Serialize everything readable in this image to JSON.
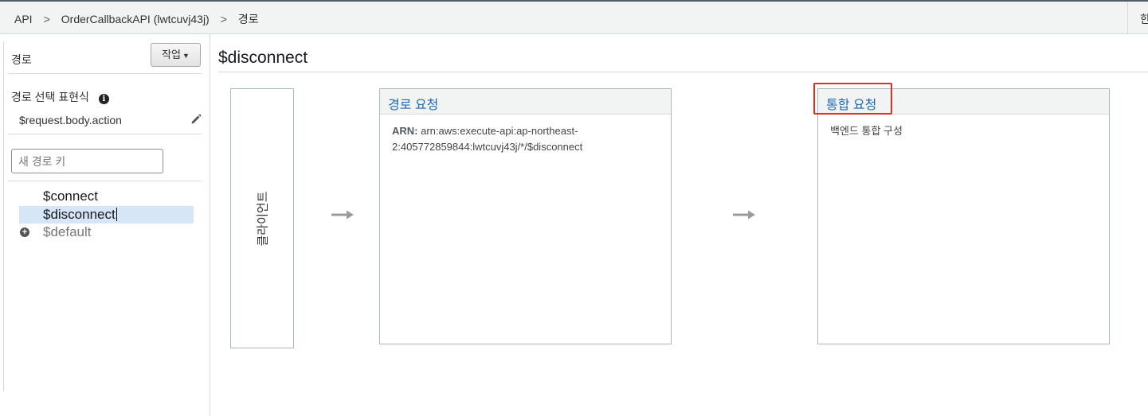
{
  "breadcrumb": {
    "items": [
      "API",
      "OrderCallbackAPI (lwtcuvj43j)",
      "경로"
    ],
    "separator": ">",
    "right_partial": "한"
  },
  "sidebar": {
    "title": "경로",
    "actions_button": "작업",
    "selection_expression_label": "경로 선택 표현식",
    "selection_expression_value": "$request.body.action",
    "new_route_placeholder": "새 경로 키",
    "routes": [
      "$connect",
      "$disconnect",
      "$default"
    ],
    "selected_route": "$disconnect"
  },
  "main": {
    "title": "$disconnect",
    "client_label": "클라이언트",
    "route_request": {
      "title": "경로 요청",
      "arn_label": "ARN:",
      "arn_value": "arn:aws:execute-api:ap-northeast-2:405772859844:lwtcuvj43j/*/$disconnect"
    },
    "integration_request": {
      "title": "통합 요청",
      "body": "백엔드 통합 구성"
    }
  },
  "colors": {
    "link": "#1a6ab8",
    "selected_row": "#d6e6f7",
    "highlight": "#e0301e"
  }
}
